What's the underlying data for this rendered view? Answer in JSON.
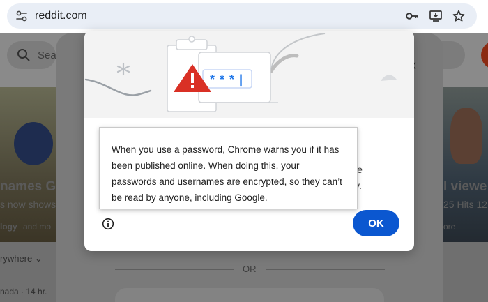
{
  "browser": {
    "url": "reddit.com",
    "icons": [
      "tune-icon",
      "key-icon",
      "install-app-icon",
      "star-icon"
    ]
  },
  "background_page": {
    "search_placeholder": "Sea",
    "left_card": {
      "title": "names G",
      "subtitle": "s now shows",
      "tag": "logy",
      "tag_extra": "and mo"
    },
    "right_card": {
      "title": "l viewe",
      "subtitle": "25 Hits 12",
      "tag": "ore"
    },
    "filter": "rywhere",
    "meta": "nada · 14 hr.",
    "or_text": "OR"
  },
  "dialog": {
    "partial_text_1": "le",
    "partial_text_2": "y.",
    "ok_label": "OK",
    "accent_color": "#0b57d0",
    "warning_color": "#d93025",
    "masked_password": "***|"
  },
  "tooltip": {
    "text": "When you use a password, Chrome warns you if it has been published online. When doing this, your passwords and usernames are encrypted, so they can’t be read by anyone, including Google."
  }
}
